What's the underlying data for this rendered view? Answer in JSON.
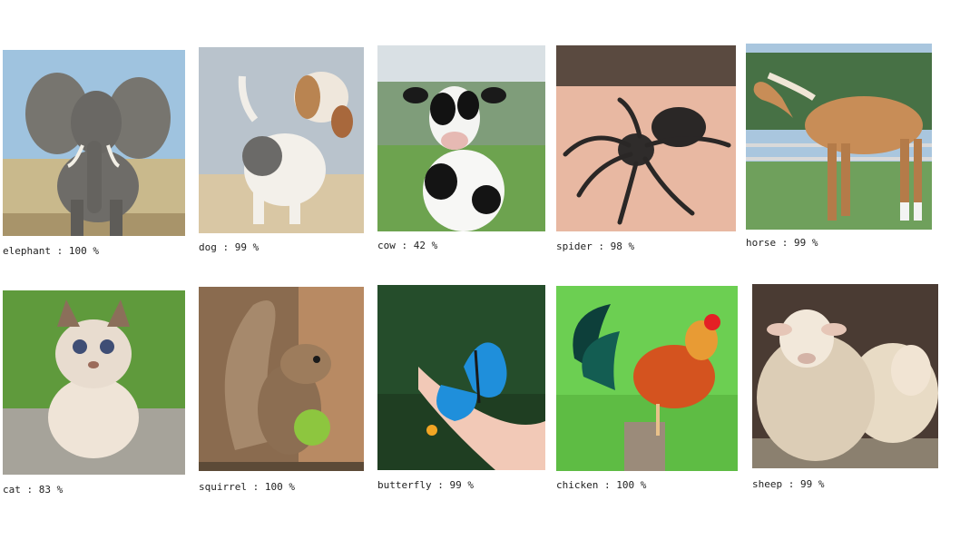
{
  "gallery": {
    "items": [
      {
        "caption": "elephant : 100 %",
        "subject": "elephant",
        "icon": "elephant-photo"
      },
      {
        "caption": "dog : 99 %",
        "subject": "dog",
        "icon": "dog-photo"
      },
      {
        "caption": "cow : 42 %",
        "subject": "cow",
        "icon": "cow-photo"
      },
      {
        "caption": "spider : 98 %",
        "subject": "spider",
        "icon": "spider-photo"
      },
      {
        "caption": "horse : 99 %",
        "subject": "horse",
        "icon": "horse-photo"
      },
      {
        "caption": "cat : 83 %",
        "subject": "cat",
        "icon": "cat-photo"
      },
      {
        "caption": "squirrel : 100 %",
        "subject": "squirrel",
        "icon": "squirrel-photo"
      },
      {
        "caption": "butterfly : 99 %",
        "subject": "butterfly",
        "icon": "butterfly-photo"
      },
      {
        "caption": "chicken : 100 %",
        "subject": "chicken",
        "icon": "chicken-photo"
      },
      {
        "caption": "sheep : 99 %",
        "subject": "sheep",
        "icon": "sheep-photo"
      }
    ]
  }
}
